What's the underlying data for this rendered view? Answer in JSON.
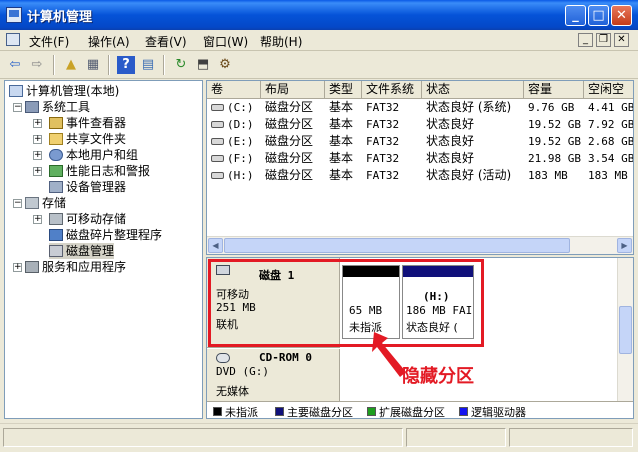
{
  "window": {
    "title": "计算机管理"
  },
  "window_buttons": {
    "minimize": "_",
    "maximize": "□",
    "close": "✕"
  },
  "menu": {
    "items": [
      "文件(F)",
      "操作(A)",
      "查看(V)",
      "窗口(W)",
      "帮助(H)"
    ],
    "mdi_buttons": [
      "_",
      "❐",
      "✕"
    ]
  },
  "toolbar": {
    "tools": [
      {
        "icon": "back-arrow-icon",
        "glyph": "⇦"
      },
      {
        "icon": "forward-arrow-icon",
        "glyph": "⇨"
      },
      {
        "icon": "up-folder-icon",
        "glyph": "▲"
      },
      {
        "icon": "show-hide-tree-icon",
        "glyph": "▦"
      },
      {
        "icon": "help-icon",
        "glyph": "?"
      },
      {
        "icon": "properties-icon",
        "glyph": "▤"
      },
      {
        "icon": "refresh-icon",
        "glyph": "↻"
      },
      {
        "icon": "export-icon",
        "glyph": "⬒"
      },
      {
        "icon": "settings-icon",
        "glyph": "⚙"
      }
    ]
  },
  "tree": {
    "root": "计算机管理(本地)",
    "system_tools": "系统工具",
    "event_viewer": "事件查看器",
    "shared_folders": "共享文件夹",
    "local_users": "本地用户和组",
    "perf_logs": "性能日志和警报",
    "device_manager": "设备管理器",
    "storage": "存储",
    "removable": "可移动存储",
    "defrag": "磁盘碎片整理程序",
    "disk_mgmt": "磁盘管理",
    "services": "服务和应用程序"
  },
  "table": {
    "headers": [
      "卷",
      "布局",
      "类型",
      "文件系统",
      "状态",
      "容量",
      "空闲空"
    ],
    "rows": [
      {
        "vol": "(C:)",
        "layout": "磁盘分区",
        "type": "基本",
        "fs": "FAT32",
        "status": "状态良好 (系统)",
        "cap": "9.76 GB",
        "free": "4.41 GB"
      },
      {
        "vol": "(D:)",
        "layout": "磁盘分区",
        "type": "基本",
        "fs": "FAT32",
        "status": "状态良好",
        "cap": "19.52 GB",
        "free": "7.92 GB"
      },
      {
        "vol": "(E:)",
        "layout": "磁盘分区",
        "type": "基本",
        "fs": "FAT32",
        "status": "状态良好",
        "cap": "19.52 GB",
        "free": "2.68 GB"
      },
      {
        "vol": "(F:)",
        "layout": "磁盘分区",
        "type": "基本",
        "fs": "FAT32",
        "status": "状态良好",
        "cap": "21.98 GB",
        "free": "3.54 GB"
      },
      {
        "vol": "(H:)",
        "layout": "磁盘分区",
        "type": "基本",
        "fs": "FAT32",
        "status": "状态良好 (活动)",
        "cap": "183 MB",
        "free": "183 MB"
      }
    ]
  },
  "disks": [
    {
      "name": "磁盘 1",
      "type": "可移动",
      "size": "251 MB",
      "state": "联机"
    },
    {
      "name": "CD-ROM 0",
      "type": "DVD (G:)",
      "media": "无媒体"
    }
  ],
  "partitions": [
    {
      "label": "",
      "size": "65 MB",
      "status": "未指派",
      "bar_color": "#000000"
    },
    {
      "label": "(H:)",
      "size": "186 MB FAI",
      "status": "状态良好 (",
      "bar_color": "#10107a"
    }
  ],
  "legend": [
    {
      "label": "未指派",
      "color": "#000000"
    },
    {
      "label": "主要磁盘分区",
      "color": "#10107a"
    },
    {
      "label": "扩展磁盘分区",
      "color": "#1e9e1e"
    },
    {
      "label": "逻辑驱动器",
      "color": "#1414f0"
    }
  ],
  "annotation": {
    "text": "隐藏分区",
    "color": "#e31a24"
  }
}
